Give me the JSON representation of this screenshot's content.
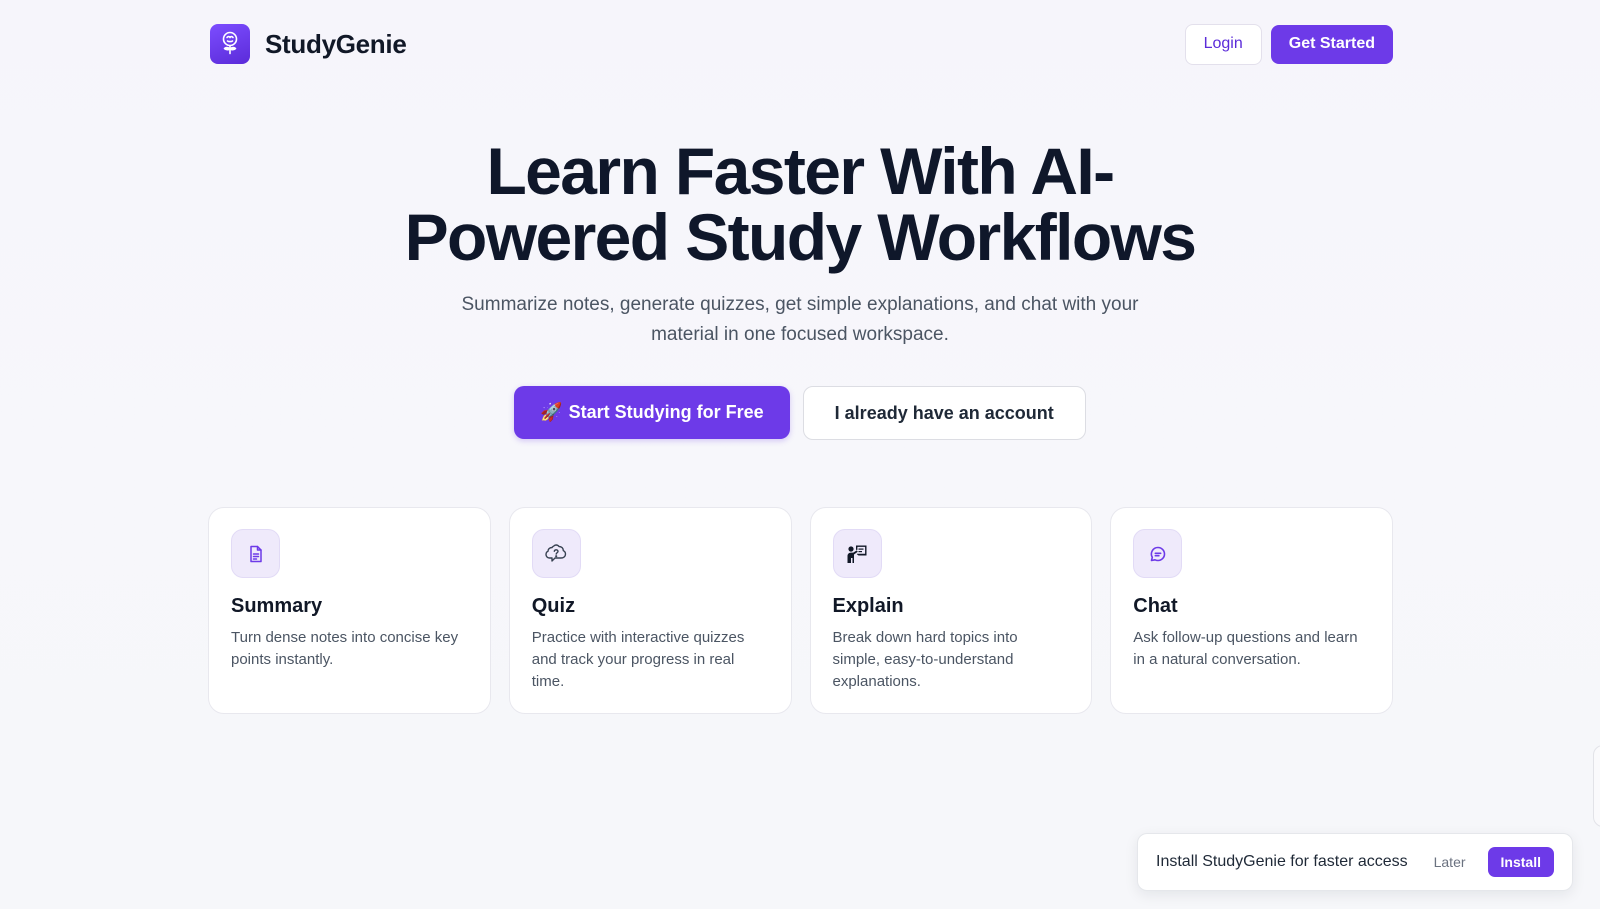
{
  "header": {
    "brand_name": "StudyGenie",
    "login_label": "Login",
    "get_started_label": "Get Started"
  },
  "hero": {
    "title_line1": "Learn Faster With AI-",
    "title_line2": "Powered Study Workflows",
    "subtitle_line1": "Summarize notes, generate quizzes, get simple explanations, and chat with your",
    "subtitle_line2": "material in one focused workspace.",
    "primary_cta_emoji": "🚀",
    "primary_cta_label": "Start Studying for Free",
    "secondary_cta_label": "I already have an account"
  },
  "features": [
    {
      "icon": "document-icon",
      "title": "Summary",
      "description": "Turn dense notes into concise key points instantly."
    },
    {
      "icon": "brain-question-icon",
      "title": "Quiz",
      "description": "Practice with interactive quizzes and track your progress in real time."
    },
    {
      "icon": "presenter-icon",
      "title": "Explain",
      "description": "Break down hard topics into simple, easy-to-understand explanations."
    },
    {
      "icon": "chat-bubble-icon",
      "title": "Chat",
      "description": "Ask follow-up questions and learn in a natural conversation."
    }
  ],
  "install_banner": {
    "message": "Install StudyGenie for faster access",
    "later_label": "Later",
    "install_label": "Install"
  },
  "colors": {
    "accent": "#6d3ae8",
    "icon_tile_bg": "#efeafb",
    "heading": "#0f172a",
    "body_text": "#4b5563"
  }
}
